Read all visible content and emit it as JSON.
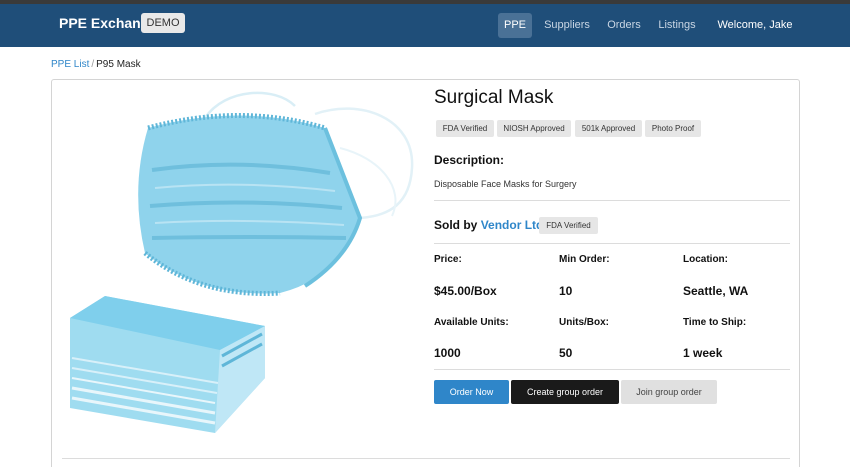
{
  "navbar": {
    "brand": "PPE Exchange",
    "demo_badge": "DEMO",
    "items": [
      {
        "label": "PPE",
        "active": true
      },
      {
        "label": "Suppliers"
      },
      {
        "label": "Orders"
      },
      {
        "label": "Listings"
      },
      {
        "label": "Welcome, Jake"
      }
    ]
  },
  "breadcrumb": {
    "parent": "PPE List",
    "separator": "/",
    "current": "P95 Mask"
  },
  "product": {
    "title": "Surgical Mask",
    "badges": [
      "FDA Verified",
      "NIOSH Approved",
      "501k Approved",
      "Photo Proof"
    ],
    "description_heading": "Description:",
    "description": "Disposable Face Masks for Surgery",
    "sold_by_prefix": "Sold by",
    "vendor": "Vendor Ltd",
    "vendor_badge": "FDA Verified",
    "fields": [
      {
        "label": "Price:",
        "value": "$45.00/Box"
      },
      {
        "label": "Min Order:",
        "value": "10"
      },
      {
        "label": "Location:",
        "value": "Seattle, WA"
      },
      {
        "label": "Available Units:",
        "value": "1000"
      },
      {
        "label": "Units/Box:",
        "value": "50"
      },
      {
        "label": "Time to Ship:",
        "value": "1 week"
      }
    ]
  },
  "actions": {
    "order_now": "Order Now",
    "create_group": "Create group order",
    "join_group": "Join group order"
  },
  "colors": {
    "navbar": "#1f4e79",
    "link": "#2f86c9",
    "primary_button": "#2f86c9",
    "dark_button": "#1a1a1a",
    "mask_blue": "#8fd3ec"
  }
}
